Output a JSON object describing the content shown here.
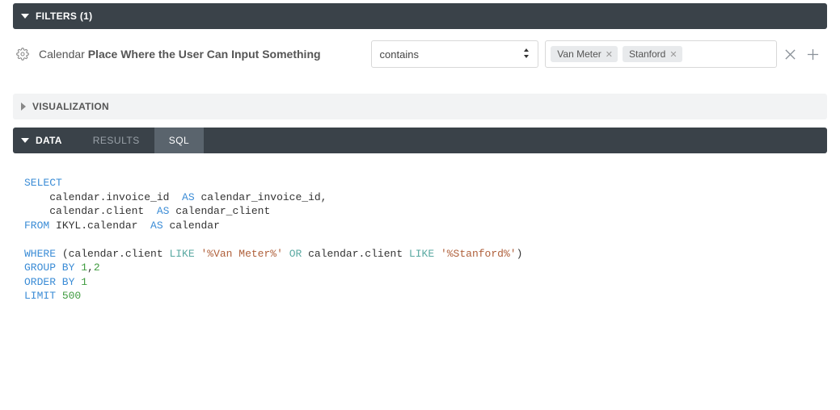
{
  "filters_bar": {
    "label": "FILTERS (1)"
  },
  "filter_row": {
    "label_light": "Calendar",
    "label_bold": "Place Where the User Can Input Something",
    "operator": "contains",
    "tags": [
      "Van Meter",
      "Stanford"
    ]
  },
  "visualization_bar": {
    "label": "VISUALIZATION"
  },
  "data_bar": {
    "label": "DATA",
    "tabs": [
      {
        "label": "RESULTS",
        "active": false
      },
      {
        "label": "SQL",
        "active": true
      }
    ]
  },
  "sql": {
    "select": "SELECT",
    "line1a": "    calendar.invoice_id  ",
    "as1": "AS",
    "line1b": " calendar_invoice_id,",
    "line2a": "    calendar.client  ",
    "as2": "AS",
    "line2b": " calendar_client",
    "from": "FROM",
    "frombody": " IKYL.calendar  ",
    "as3": "AS",
    "frombody2": " calendar",
    "where": "WHERE",
    "where_a": " (calendar.client ",
    "like1": "LIKE",
    "lit1": " '%Van Meter%'",
    "or": " OR",
    "where_b": " calendar.client ",
    "like2": "LIKE",
    "lit2": " '%Stanford%'",
    "where_c": ")",
    "groupby": "GROUP BY",
    "gb_vals": " 1",
    "gb_comma": ",",
    "gb_vals2": "2",
    "orderby": "ORDER BY",
    "ob_vals": " 1",
    "limit": "LIMIT",
    "limit_val": " 500"
  }
}
